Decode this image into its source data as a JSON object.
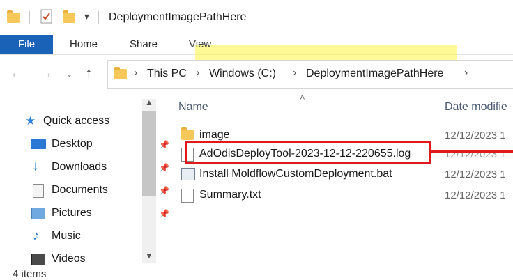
{
  "window": {
    "title": "DeploymentImagePathHere"
  },
  "ribbon": {
    "tabs": [
      "File",
      "Home",
      "Share",
      "View"
    ]
  },
  "address": {
    "crumbs": [
      "This PC",
      "Windows (C:)",
      "DeploymentImagePathHere"
    ]
  },
  "sidebar": {
    "items": [
      {
        "label": "Quick access",
        "icon": "star-icon"
      },
      {
        "label": "Desktop",
        "icon": "desktop-icon",
        "pinned": true
      },
      {
        "label": "Downloads",
        "icon": "download-icon",
        "pinned": true
      },
      {
        "label": "Documents",
        "icon": "documents-icon",
        "pinned": true
      },
      {
        "label": "Pictures",
        "icon": "pictures-icon",
        "pinned": true
      },
      {
        "label": "Music",
        "icon": "music-icon"
      },
      {
        "label": "Videos",
        "icon": "videos-icon"
      }
    ]
  },
  "list": {
    "columns": {
      "name": "Name",
      "date": "Date modifie"
    },
    "files": [
      {
        "name": "image",
        "date": "12/12/2023 1",
        "icon": "folder-icon"
      },
      {
        "name": "AdOdisDeployTool-2023-12-12-220655.log",
        "date": "12/12/2023 1",
        "icon": "text-file-icon",
        "highlighted": true
      },
      {
        "name": "Install MoldflowCustomDeployment.bat",
        "date": "12/12/2023 1",
        "icon": "batch-file-icon"
      },
      {
        "name": "Summary.txt",
        "date": "12/12/2023 1",
        "icon": "text-file-icon"
      }
    ]
  },
  "status": {
    "count": "4 items"
  },
  "colors": {
    "accent": "#1a62b8",
    "annotation": "#e01a1a",
    "highlight": "#fff550"
  }
}
